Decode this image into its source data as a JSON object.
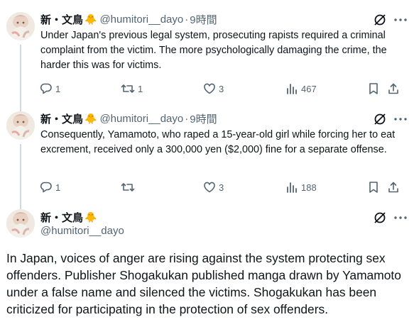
{
  "tweets": [
    {
      "name": "新・文鳥",
      "emoji": "🐥",
      "handle": "@humitori__dayo",
      "separator": "·",
      "time": "9時間",
      "text": "Under Japan's previous legal system, prosecuting rapists required a criminal complaint from the victim. The more psychologically damaging the crime, the harder this was for victims.",
      "replies": "1",
      "reposts": "1",
      "likes": "3",
      "views": "467"
    },
    {
      "name": "新・文鳥",
      "emoji": "🐥",
      "handle": "@humitori__dayo",
      "separator": "·",
      "time": "9時間",
      "text": "Consequently, Yamamoto, who raped a 15-year-old girl while forcing her to eat excrement, received only a 300,000 yen ($2,000) fine for a separate offense.",
      "replies": "1",
      "reposts": "",
      "likes": "3",
      "views": "188"
    }
  ],
  "main_tweet": {
    "name": "新・文鳥",
    "emoji": "🐥",
    "handle": "@humitori__dayo",
    "text": "In Japan, voices of anger are rising against the system protecting sex offenders. Publisher Shogakukan published manga drawn by Yamamoto under a false name and silenced the victims. Shogakukan has been criticized for participating in the protection of sex offenders."
  },
  "icons": {
    "reply": "reply-icon",
    "repost": "repost-icon",
    "like": "like-icon",
    "views": "views-icon",
    "bookmark": "bookmark-icon",
    "share": "share-icon",
    "grok": "grok-icon",
    "more": "more-icon"
  },
  "colors": {
    "text": "#0f1419",
    "secondary": "#536471",
    "connector": "#cfd9de",
    "background": "#ffffff"
  }
}
